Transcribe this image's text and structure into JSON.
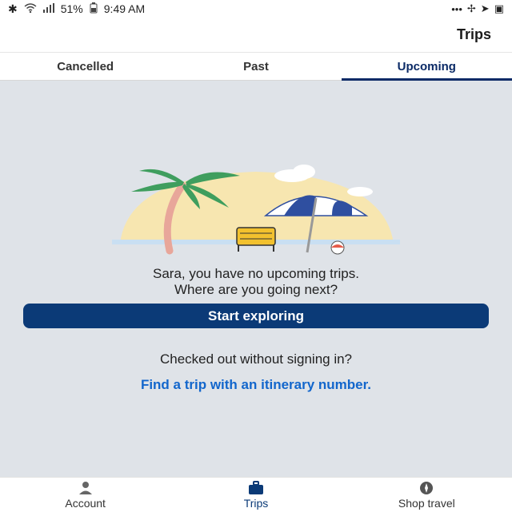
{
  "status_bar": {
    "time": "9:49 AM",
    "battery": "51%",
    "icons": [
      "bluetooth-icon",
      "wifi-icon",
      "signal-icon",
      "battery-icon",
      "gallery-icon",
      "send-icon",
      "fan-icon",
      "more-icon"
    ]
  },
  "header": {
    "title": "Trips"
  },
  "tabs": [
    {
      "label": "Upcoming",
      "active": true
    },
    {
      "label": "Past",
      "active": false
    },
    {
      "label": "Cancelled",
      "active": false
    }
  ],
  "empty_state": {
    "line1": "Sara, you have no upcoming trips.",
    "line2": "Where are you going next?",
    "cta_label": "Start exploring",
    "checked_out_text": "Checked out without signing in?",
    "find_trip_link": "Find a trip with an itinerary number."
  },
  "bottom_nav": [
    {
      "label": "Shop travel",
      "icon": "compass-icon",
      "active": false
    },
    {
      "label": "Trips",
      "icon": "suitcase-icon",
      "active": true
    },
    {
      "label": "Account",
      "icon": "person-icon",
      "active": false
    }
  ],
  "colors": {
    "primary": "#0b3a77",
    "link": "#1266cc",
    "background": "#dfe3e8"
  }
}
